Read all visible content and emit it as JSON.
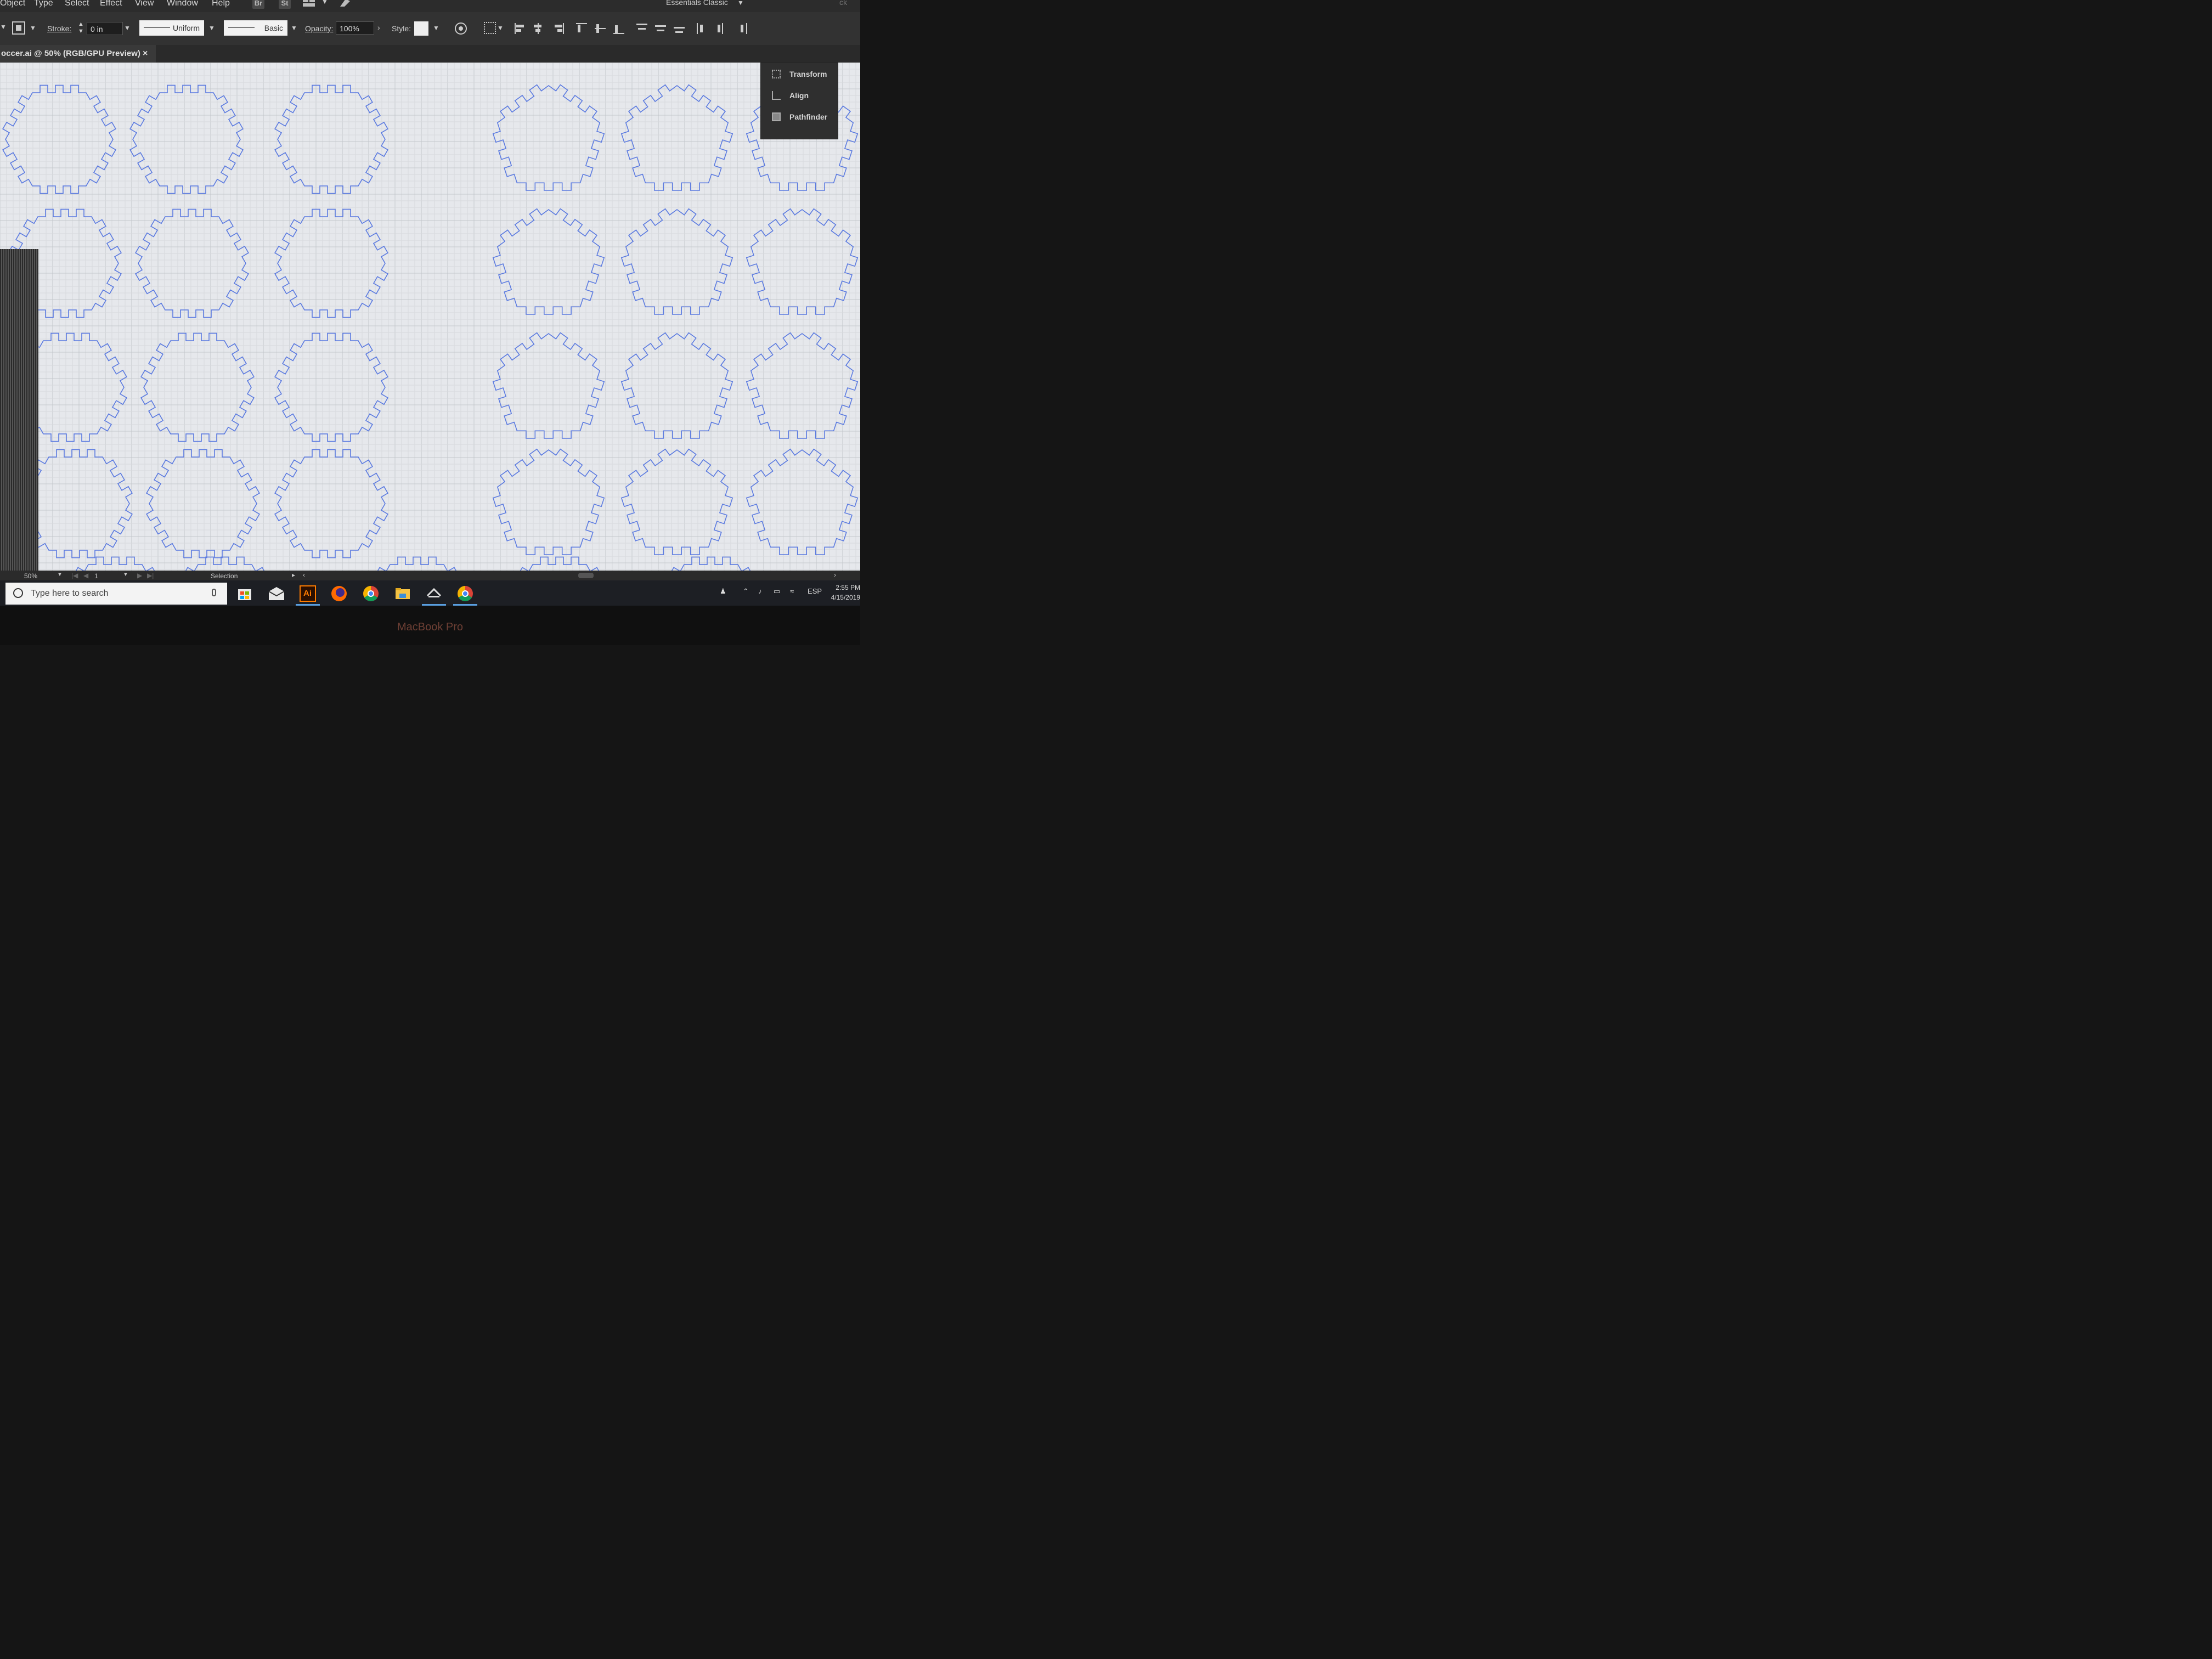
{
  "menubar": {
    "items": [
      "Object",
      "Type",
      "Select",
      "Effect",
      "View",
      "Window",
      "Help"
    ],
    "badges": [
      "Br",
      "St"
    ],
    "workspace": "Essentials Classic",
    "right_fragment": "ck"
  },
  "control_bar": {
    "stroke_label": "Stroke:",
    "stroke_value": "0 in",
    "profile_uniform": "Uniform",
    "brush_basic": "Basic",
    "opacity_label": "Opacity:",
    "opacity_value": "100%",
    "style_label": "Style:"
  },
  "document_tab": {
    "title": "occer.ai @ 50% (RGB/GPU Preview)",
    "close": "×"
  },
  "panel": {
    "items": [
      {
        "label": "Transform",
        "icon": "transform-icon"
      },
      {
        "label": "Align",
        "icon": "align-icon"
      },
      {
        "label": "Pathfinder",
        "icon": "pathfinder-icon"
      }
    ]
  },
  "canvas": {
    "shape_color": "#5c7be0",
    "columns": [
      "hexagon",
      "hexagon",
      "hexagon",
      "pentagon",
      "pentagon",
      "pentagon"
    ]
  },
  "status_bar": {
    "zoom": "50%",
    "artboard": "1",
    "tool": "Selection"
  },
  "taskbar": {
    "search_placeholder": "Type here to search",
    "apps": [
      "store-icon",
      "mail-icon",
      "illustrator-icon",
      "firefox-icon",
      "chrome-icon",
      "file-explorer-icon",
      "app-icon",
      "chrome-icon"
    ],
    "ai_label": "Ai",
    "lang": "ESP",
    "time": "2:55 PM",
    "date": "4/15/2019"
  },
  "bezel": {
    "label": "MacBook Pro"
  }
}
